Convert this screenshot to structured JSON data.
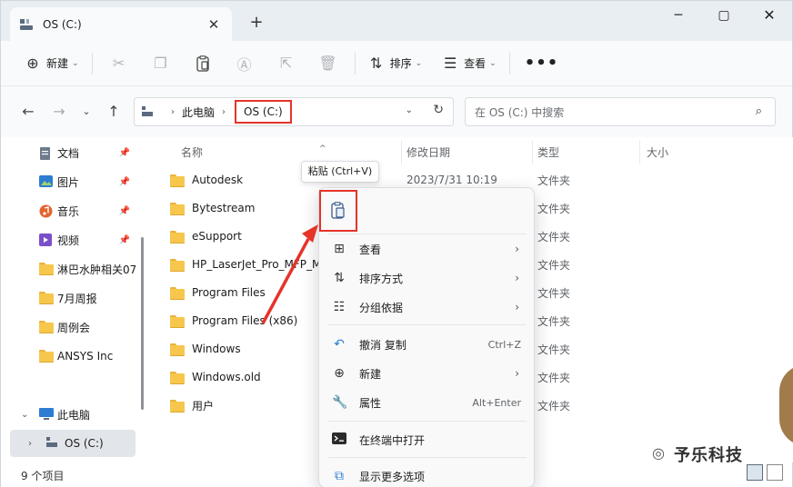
{
  "window": {
    "tab_title": "OS (C:)",
    "tab_close": "✕",
    "new_tab": "+",
    "min": "─",
    "max": "▢",
    "close": "✕"
  },
  "toolbar": {
    "new_label": "新建",
    "sort_label": "排序",
    "view_label": "查看",
    "more": "•••"
  },
  "address": {
    "crumbs": [
      "此电脑",
      "OS (C:)"
    ],
    "search_placeholder": "在 OS (C:) 中搜索"
  },
  "sidebar": {
    "items": [
      {
        "label": "文档",
        "icon": "document-icon",
        "pinned": true
      },
      {
        "label": "图片",
        "icon": "pictures-icon",
        "pinned": true
      },
      {
        "label": "音乐",
        "icon": "music-icon",
        "pinned": true
      },
      {
        "label": "视频",
        "icon": "video-icon",
        "pinned": true
      },
      {
        "label": "淋巴水肿相关07",
        "icon": "folder-icon",
        "pinned": false
      },
      {
        "label": "7月周报",
        "icon": "folder-icon",
        "pinned": false
      },
      {
        "label": "周例会",
        "icon": "folder-icon",
        "pinned": false
      },
      {
        "label": "ANSYS Inc",
        "icon": "folder-icon",
        "pinned": false
      },
      {
        "label": "此电脑",
        "icon": "computer-icon",
        "pinned": false
      },
      {
        "label": "OS (C:)",
        "icon": "drive-icon",
        "pinned": false
      }
    ]
  },
  "filelist": {
    "headers": {
      "name": "名称",
      "date": "修改日期",
      "type": "类型",
      "size": "大小"
    },
    "rows": [
      {
        "name": "Autodesk",
        "date": "2023/7/31 10:19",
        "type": "文件夹"
      },
      {
        "name": "Bytestream",
        "date": "",
        "type": "文件夹"
      },
      {
        "name": "eSupport",
        "date": "",
        "type": "文件夹"
      },
      {
        "name": "HP_LaserJet_Pro_MFP_M1",
        "date": "",
        "type": "文件夹"
      },
      {
        "name": "Program Files",
        "date": "",
        "type": "文件夹"
      },
      {
        "name": "Program Files (x86)",
        "date": "",
        "type": "文件夹"
      },
      {
        "name": "Windows",
        "date": "",
        "type": "文件夹"
      },
      {
        "name": "Windows.old",
        "date": "",
        "type": "文件夹"
      },
      {
        "name": "用户",
        "date": "",
        "type": "文件夹"
      }
    ]
  },
  "status": {
    "item_count": "9 个项目"
  },
  "tooltip": {
    "text": "粘贴 (Ctrl+V)"
  },
  "context_menu": {
    "items": [
      {
        "label": "查看",
        "icon": "grid-icon",
        "submenu": true
      },
      {
        "label": "排序方式",
        "icon": "sort-icon",
        "submenu": true
      },
      {
        "label": "分组依据",
        "icon": "group-icon",
        "submenu": true
      },
      {
        "label": "撤消 复制",
        "icon": "undo-icon",
        "shortcut": "Ctrl+Z"
      },
      {
        "label": "新建",
        "icon": "new-icon",
        "submenu": true
      },
      {
        "label": "属性",
        "icon": "properties-icon",
        "shortcut": "Alt+Enter"
      },
      {
        "label": "在终端中打开",
        "icon": "terminal-icon"
      },
      {
        "label": "显示更多选项",
        "icon": "more-options-icon"
      }
    ]
  },
  "watermark": {
    "text": "予乐科技",
    "logo": "wechat-icon"
  },
  "colors": {
    "accent_red": "#e5342a",
    "folder": "#f6c74c"
  }
}
